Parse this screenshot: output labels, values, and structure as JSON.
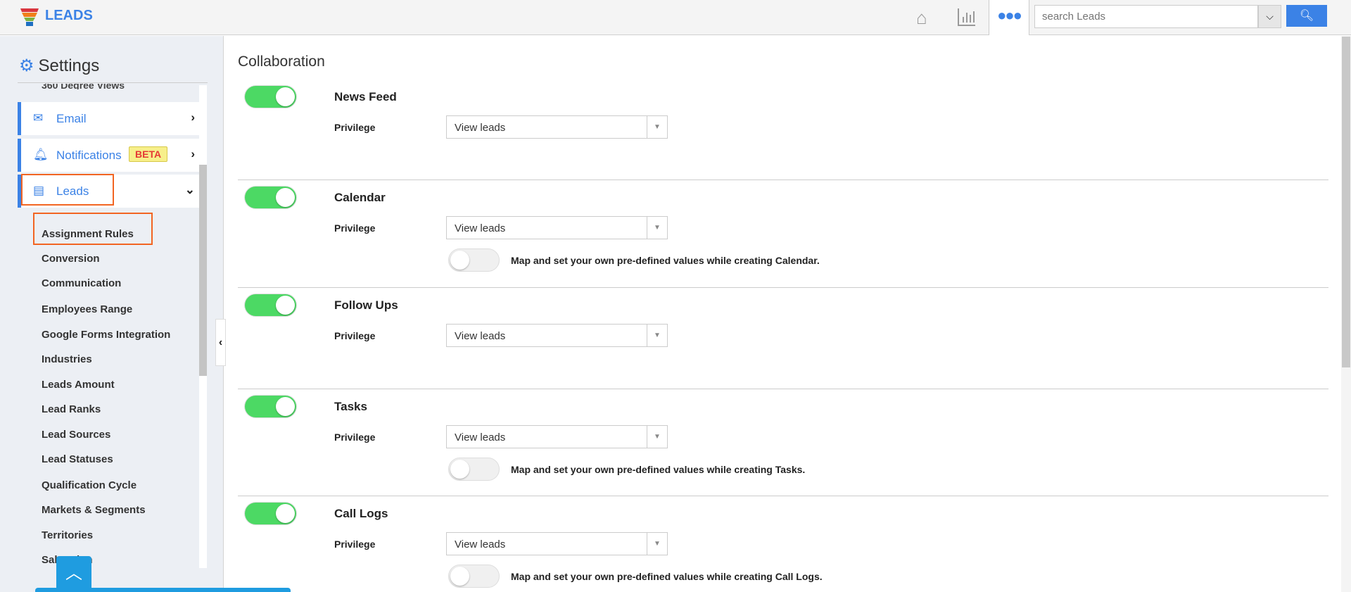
{
  "header": {
    "brand": "LEADS",
    "search_placeholder": "search Leads",
    "icons": [
      "funnel-logo",
      "home-icon",
      "chart-icon",
      "more-icon",
      "chevron-down-icon",
      "search-icon"
    ]
  },
  "sidebar": {
    "title": "Settings",
    "cut_item": "360 Degree Views",
    "menu": [
      {
        "label": "Email"
      },
      {
        "label": "Notifications",
        "badge": "BETA"
      },
      {
        "label": "Leads"
      }
    ],
    "sub_items": [
      "Assignment Rules",
      "Conversion",
      "Communication",
      "Employees Range",
      "Google Forms Integration",
      "Industries",
      "Leads Amount",
      "Lead Ranks",
      "Lead Sources",
      "Lead Statuses",
      "Qualification Cycle",
      "Markets & Segments",
      "Territories",
      "Salutation"
    ]
  },
  "main": {
    "title": "Collaboration",
    "privilege_label": "Privilege",
    "sections": [
      {
        "name": "News Feed",
        "enabled": true,
        "privilege": "View leads"
      },
      {
        "name": "Calendar",
        "enabled": true,
        "privilege": "View leads",
        "map_text": "Map and set your own pre-defined values while creating Calendar.",
        "map_enabled": false
      },
      {
        "name": "Follow Ups",
        "enabled": true,
        "privilege": "View leads"
      },
      {
        "name": "Tasks",
        "enabled": true,
        "privilege": "View leads",
        "map_text": "Map and set your own pre-defined values while creating Tasks.",
        "map_enabled": false
      },
      {
        "name": "Call Logs",
        "enabled": true,
        "privilege": "View leads",
        "map_text": "Map and set your own pre-defined values while creating Call Logs.",
        "map_enabled": false
      }
    ]
  },
  "colors": {
    "accent": "#3b82e6",
    "toggle_on": "#4cd964",
    "highlight": "#f26522",
    "scroll_top": "#1f9ce0"
  }
}
